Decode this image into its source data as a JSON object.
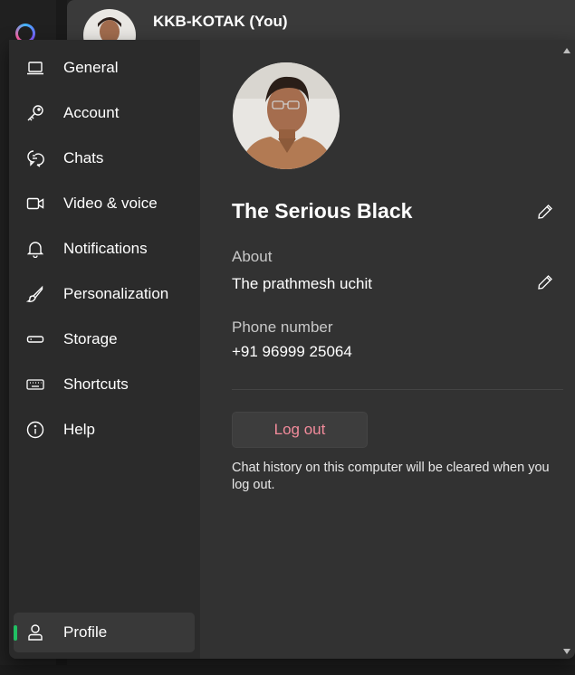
{
  "chat_header": {
    "name": "KKB-KOTAK (You)"
  },
  "nav": {
    "items": [
      {
        "label": "General",
        "icon": "laptop-icon"
      },
      {
        "label": "Account",
        "icon": "key-icon"
      },
      {
        "label": "Chats",
        "icon": "chat-bubbles-icon"
      },
      {
        "label": "Video & voice",
        "icon": "video-camera-icon"
      },
      {
        "label": "Notifications",
        "icon": "bell-icon"
      },
      {
        "label": "Personalization",
        "icon": "brush-icon"
      },
      {
        "label": "Storage",
        "icon": "storage-icon"
      },
      {
        "label": "Shortcuts",
        "icon": "keyboard-icon"
      },
      {
        "label": "Help",
        "icon": "info-icon"
      }
    ],
    "profile": {
      "label": "Profile",
      "icon": "person-icon",
      "active": true
    }
  },
  "profile": {
    "name": "The Serious Black",
    "about_label": "About",
    "about_value": "The prathmesh uchit",
    "phone_label": "Phone number",
    "phone_value": "+91 96999 25064",
    "logout_label": "Log out",
    "logout_note": "Chat history on this computer will be cleared when you log out."
  },
  "colors": {
    "accent_green": "#21c063",
    "logout_text": "#f28b9b",
    "panel_bg": "#2b2b2b",
    "content_bg": "#323232"
  }
}
